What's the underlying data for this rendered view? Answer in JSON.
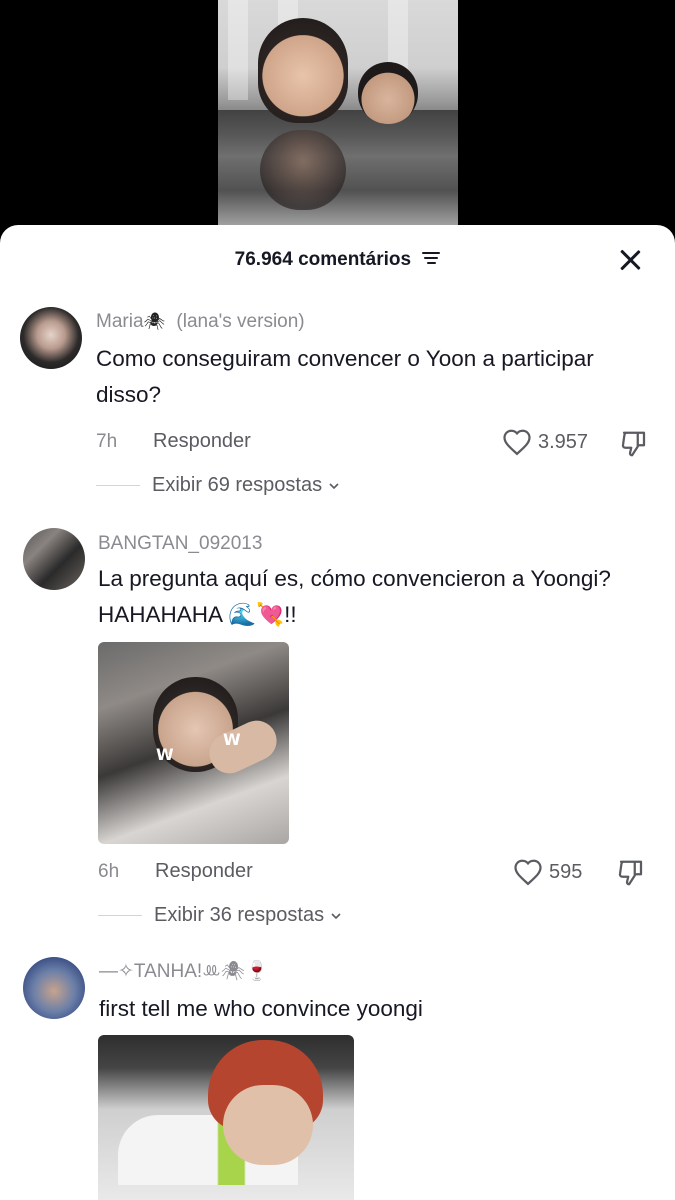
{
  "header": {
    "comment_count": "76.964 comentários"
  },
  "comments": [
    {
      "username": "Maria",
      "username_suffix": "(lana's version)",
      "username_emoji": "🕷",
      "text": "Como conseguiram convencer o Yoon a participar disso?",
      "time": "7h",
      "reply_label": "Responder",
      "likes": "3.957",
      "view_replies": "Exibir 69 respostas"
    },
    {
      "username": "BANGTAN_092013",
      "text": "La pregunta aquí es, cómo convencieron a Yoongi? HAHAHAHA 🌊💘!!",
      "time": "6h",
      "reply_label": "Responder",
      "likes": "595",
      "view_replies": "Exibir 36 respostas",
      "attachment_marks": [
        "W",
        "W"
      ]
    },
    {
      "username": "—✧TANHA!ꔛ🕷🍷",
      "text": "first tell me who convince yoongi"
    }
  ],
  "colors": {
    "text_primary": "#161823",
    "text_secondary": "#8a8b91",
    "text_action": "#5b5c62"
  },
  "icons": [
    "sort-icon",
    "close-icon",
    "heart-icon",
    "dislike-icon",
    "chevron-down-icon"
  ]
}
